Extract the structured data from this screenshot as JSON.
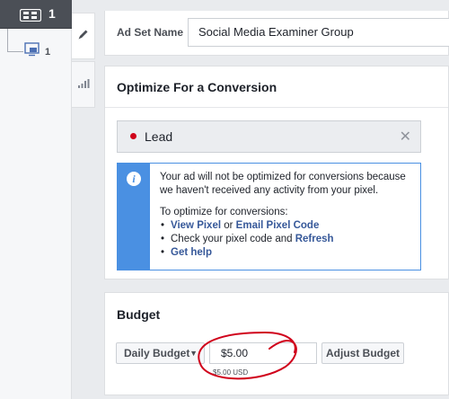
{
  "tree": {
    "campaign_count": "1",
    "adset_count": "1",
    "campaign_icon": "ad-tree-icon",
    "adset_icon": "monitor-icon"
  },
  "tabs": [
    {
      "icon": "pencil-icon",
      "active": true
    },
    {
      "icon": "bar-chart-icon",
      "active": false
    }
  ],
  "adset": {
    "name_label": "Ad Set Name",
    "name_value": "Social Media Examiner Group"
  },
  "optimize": {
    "title": "Optimize For a Conversion",
    "event_label": "Lead",
    "event_dot_color": "#d0021b",
    "clear_icon": "close-icon",
    "clear_glyph": "✕",
    "info": {
      "icon": "info-icon",
      "icon_glyph": "i",
      "message": "Your ad will not be optimized for conversions because we haven't received any activity from your pixel.",
      "intro": "To optimize for conversions:",
      "item1_link1": "View Pixel",
      "item1_sep": " or ",
      "item1_link2": "Email Pixel Code",
      "item2_text": "Check your pixel code and ",
      "item2_link": "Refresh",
      "item3_link": "Get help"
    }
  },
  "budget": {
    "title": "Budget",
    "type_label": "Daily Budget",
    "caret": "▼",
    "amount": "$5.00",
    "amount_sub": "$5.00 USD",
    "adjust_label": "Adjust Budget",
    "annotation_color": "#d0021b"
  },
  "colors": {
    "link": "#365899",
    "info_accent": "#4a90e2",
    "campaign_node_bg": "#4b4f56"
  }
}
